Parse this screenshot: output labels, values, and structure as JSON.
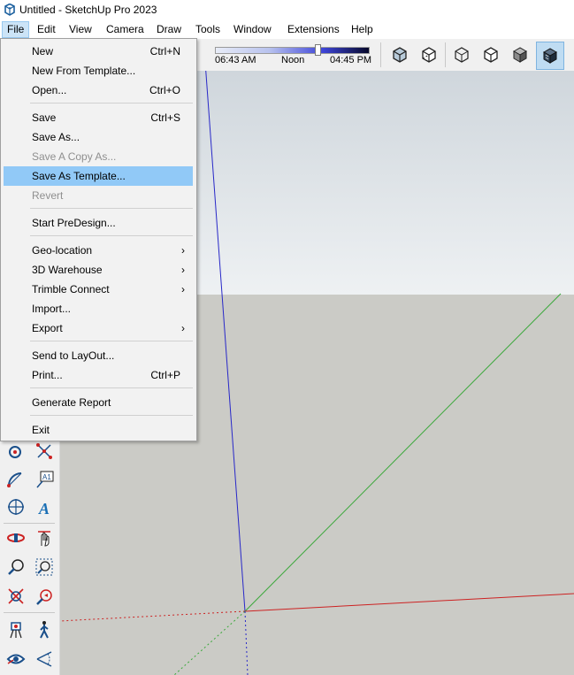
{
  "window": {
    "title": "Untitled - SketchUp Pro 2023"
  },
  "menubar": {
    "file": "File",
    "edit": "Edit",
    "view": "View",
    "camera": "Camera",
    "draw": "Draw",
    "tools": "Tools",
    "window": "Window",
    "extensions": "Extensions",
    "help": "Help"
  },
  "shadow": {
    "start": "06:43 AM",
    "mid": "Noon",
    "end": "04:45 PM"
  },
  "file_menu": {
    "new": {
      "label": "New",
      "shortcut": "Ctrl+N"
    },
    "new_from_template": {
      "label": "New From Template..."
    },
    "open": {
      "label": "Open...",
      "shortcut": "Ctrl+O"
    },
    "save": {
      "label": "Save",
      "shortcut": "Ctrl+S"
    },
    "save_as": {
      "label": "Save As..."
    },
    "save_copy_as": {
      "label": "Save A Copy As..."
    },
    "save_as_template": {
      "label": "Save As Template..."
    },
    "revert": {
      "label": "Revert"
    },
    "start_predesign": {
      "label": "Start PreDesign..."
    },
    "geo_location": {
      "label": "Geo-location"
    },
    "warehouse": {
      "label": "3D Warehouse"
    },
    "trimble_connect": {
      "label": "Trimble Connect"
    },
    "import": {
      "label": "Import..."
    },
    "export": {
      "label": "Export"
    },
    "send_to_layout": {
      "label": "Send to LayOut..."
    },
    "print": {
      "label": "Print...",
      "shortcut": "Ctrl+P"
    },
    "generate_report": {
      "label": "Generate Report"
    },
    "exit": {
      "label": "Exit"
    }
  },
  "icons": {
    "submenu_arrow": "›",
    "text_tool_glyph": "A",
    "label_tool_glyph": "A1"
  },
  "colors": {
    "highlight": "#91c9f7",
    "menu_bg": "#f2f2f2",
    "axis_red": "#cc2222",
    "axis_green": "#33aa33",
    "axis_blue": "#2222cc",
    "ground": "#cbcbc6"
  }
}
